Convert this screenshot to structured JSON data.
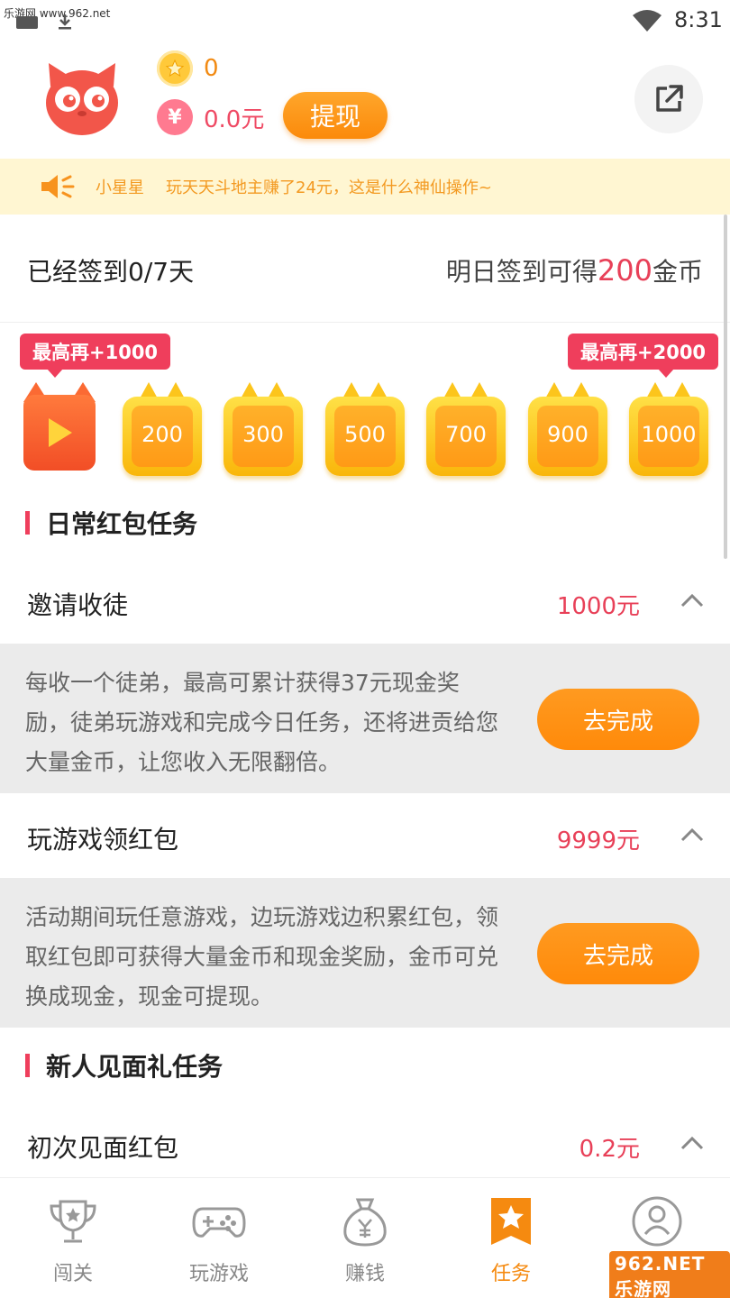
{
  "status_bar": {
    "watermark": "乐游网 www.962.net",
    "time": "8:31"
  },
  "header": {
    "coins": "0",
    "cash": "0.0元",
    "withdraw_label": "提现",
    "cash_icon": "¥"
  },
  "notice": {
    "name": "小星星",
    "message": "玩天天斗地主赚了24元，这是什么神仙操作~"
  },
  "signin": {
    "status": "已经签到0/7天",
    "tomorrow_prefix": "明日签到可得",
    "tomorrow_amount": "200",
    "tomorrow_suffix": "金币"
  },
  "rewards": {
    "bubble_left": "最高再+1000",
    "bubble_right": "最高再+2000",
    "days": [
      "200",
      "300",
      "500",
      "700",
      "900",
      "1000"
    ]
  },
  "sections": {
    "daily_title": "日常红包任务",
    "newbie_title": "新人见面礼任务"
  },
  "tasks": [
    {
      "name": "邀请收徒",
      "amount": "1000元",
      "desc": "每收一个徒弟，最高可累计获得37元现金奖励，徒弟玩游戏和完成今日任务，还将进贡给您大量金币，让您收入无限翻倍。",
      "button": "去完成"
    },
    {
      "name": "玩游戏领红包",
      "amount": "9999元",
      "desc": "活动期间玩任意游戏，边玩游戏边积累红包，领取红包即可获得大量金币和现金奖励，金币可兑换成现金，现金可提现。",
      "button": "去完成"
    },
    {
      "name": "初次见面红包",
      "amount": "0.2元"
    }
  ],
  "tabs": [
    {
      "label": "闯关",
      "icon": "trophy-icon"
    },
    {
      "label": "玩游戏",
      "icon": "gamepad-icon"
    },
    {
      "label": "赚钱",
      "icon": "money-bag-icon"
    },
    {
      "label": "任务",
      "icon": "star-task-icon",
      "active": true
    },
    {
      "label": "",
      "icon": "user-icon"
    }
  ],
  "brand_watermark": "962.NET 乐游网",
  "colors": {
    "accent_orange": "#f58a10",
    "accent_red": "#ef3e5c",
    "notice_bg": "#fff6d2"
  }
}
